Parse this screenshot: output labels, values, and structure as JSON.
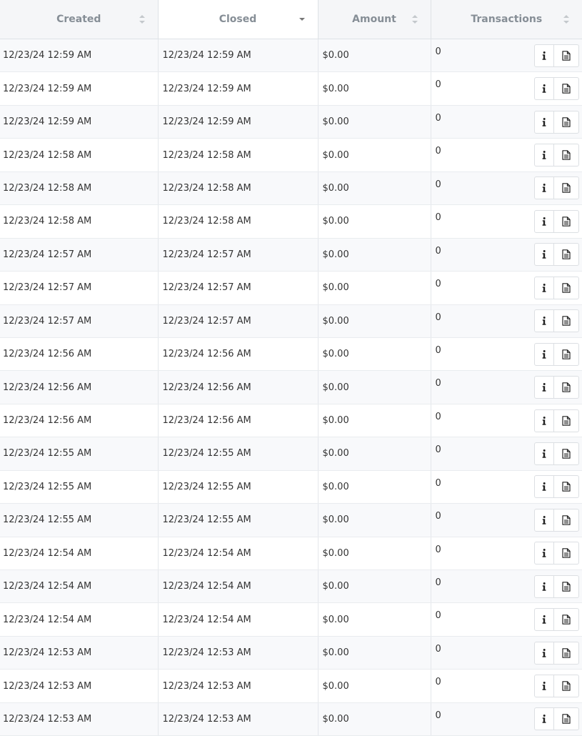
{
  "table": {
    "columns": [
      {
        "label": "Created",
        "sort": "both"
      },
      {
        "label": "Closed",
        "sort": "desc"
      },
      {
        "label": "Amount",
        "sort": "both"
      },
      {
        "label": "Transactions",
        "sort": "both"
      }
    ],
    "row_icons": [
      "info-icon",
      "document-icon"
    ],
    "rows": [
      {
        "created": "12/23/24 12:59 AM",
        "closed": "12/23/24 12:59 AM",
        "amount": "$0.00",
        "transactions": "0"
      },
      {
        "created": "12/23/24 12:59 AM",
        "closed": "12/23/24 12:59 AM",
        "amount": "$0.00",
        "transactions": "0"
      },
      {
        "created": "12/23/24 12:59 AM",
        "closed": "12/23/24 12:59 AM",
        "amount": "$0.00",
        "transactions": "0"
      },
      {
        "created": "12/23/24 12:58 AM",
        "closed": "12/23/24 12:58 AM",
        "amount": "$0.00",
        "transactions": "0"
      },
      {
        "created": "12/23/24 12:58 AM",
        "closed": "12/23/24 12:58 AM",
        "amount": "$0.00",
        "transactions": "0"
      },
      {
        "created": "12/23/24 12:58 AM",
        "closed": "12/23/24 12:58 AM",
        "amount": "$0.00",
        "transactions": "0"
      },
      {
        "created": "12/23/24 12:57 AM",
        "closed": "12/23/24 12:57 AM",
        "amount": "$0.00",
        "transactions": "0"
      },
      {
        "created": "12/23/24 12:57 AM",
        "closed": "12/23/24 12:57 AM",
        "amount": "$0.00",
        "transactions": "0"
      },
      {
        "created": "12/23/24 12:57 AM",
        "closed": "12/23/24 12:57 AM",
        "amount": "$0.00",
        "transactions": "0"
      },
      {
        "created": "12/23/24 12:56 AM",
        "closed": "12/23/24 12:56 AM",
        "amount": "$0.00",
        "transactions": "0"
      },
      {
        "created": "12/23/24 12:56 AM",
        "closed": "12/23/24 12:56 AM",
        "amount": "$0.00",
        "transactions": "0"
      },
      {
        "created": "12/23/24 12:56 AM",
        "closed": "12/23/24 12:56 AM",
        "amount": "$0.00",
        "transactions": "0"
      },
      {
        "created": "12/23/24 12:55 AM",
        "closed": "12/23/24 12:55 AM",
        "amount": "$0.00",
        "transactions": "0"
      },
      {
        "created": "12/23/24 12:55 AM",
        "closed": "12/23/24 12:55 AM",
        "amount": "$0.00",
        "transactions": "0"
      },
      {
        "created": "12/23/24 12:55 AM",
        "closed": "12/23/24 12:55 AM",
        "amount": "$0.00",
        "transactions": "0"
      },
      {
        "created": "12/23/24 12:54 AM",
        "closed": "12/23/24 12:54 AM",
        "amount": "$0.00",
        "transactions": "0"
      },
      {
        "created": "12/23/24 12:54 AM",
        "closed": "12/23/24 12:54 AM",
        "amount": "$0.00",
        "transactions": "0"
      },
      {
        "created": "12/23/24 12:54 AM",
        "closed": "12/23/24 12:54 AM",
        "amount": "$0.00",
        "transactions": "0"
      },
      {
        "created": "12/23/24 12:53 AM",
        "closed": "12/23/24 12:53 AM",
        "amount": "$0.00",
        "transactions": "0"
      },
      {
        "created": "12/23/24 12:53 AM",
        "closed": "12/23/24 12:53 AM",
        "amount": "$0.00",
        "transactions": "0"
      },
      {
        "created": "12/23/24 12:53 AM",
        "closed": "12/23/24 12:53 AM",
        "amount": "$0.00",
        "transactions": "0"
      }
    ]
  }
}
